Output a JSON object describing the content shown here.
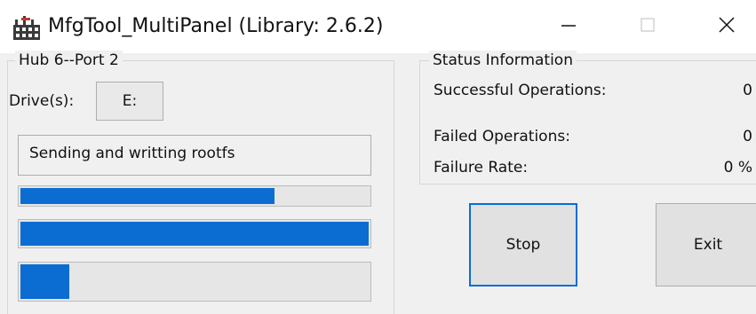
{
  "window": {
    "title": "MfgTool_MultiPanel (Library: 2.6.2)",
    "icon": "factory-icon",
    "controls": {
      "minimize_icon": "minimize-icon",
      "maximize_icon": "maximize-icon",
      "close_icon": "close-icon"
    }
  },
  "hub_panel": {
    "group_title": "Hub 6--Port 2",
    "drive_label": "Drive(s):",
    "drive_value": "E:",
    "status_text": "Sending and writting rootfs",
    "progress": [
      {
        "name": "overall-progress",
        "fraction": 0.73
      },
      {
        "name": "stage-progress",
        "fraction": 1.0
      },
      {
        "name": "file-progress",
        "fraction": 0.14
      }
    ]
  },
  "status_panel": {
    "group_title": "Status Information",
    "rows": [
      {
        "label": "Successful Operations:",
        "value": "0"
      },
      {
        "label": "Failed Operations:",
        "value": "0"
      },
      {
        "label": "Failure Rate:",
        "value": "0 %"
      }
    ]
  },
  "buttons": {
    "stop_label": "Stop",
    "exit_label": "Exit"
  },
  "colors": {
    "progress_fill": "#0b6dd1",
    "focus_border": "#0a6cd6",
    "window_bg": "#f0f0f0",
    "titlebar_bg": "#ffffff"
  }
}
